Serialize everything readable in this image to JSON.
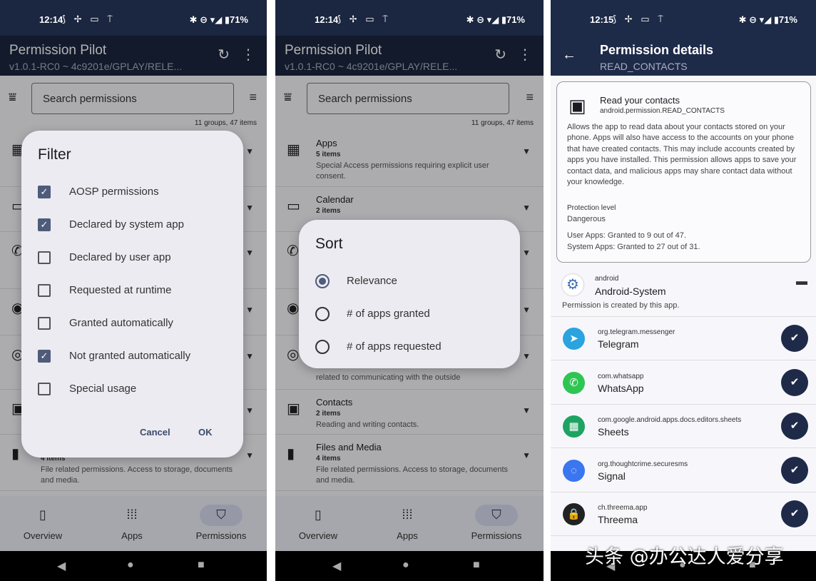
{
  "status_left": {
    "time": "12:14",
    "icons": "⟆ ✢ ▭ ⍑",
    "right": "✱ ⊖ ▾◢ ▮71%"
  },
  "status_right": {
    "time": "12:15",
    "icons": "⟆ ✢ ▭ ⍑",
    "right": "✱ ⊖ ▾◢ ▮71%"
  },
  "app": {
    "title": "Permission Pilot",
    "subtitle": "v1.0.1-RC0 ~ 4c9201e/GPLAY/RELE...",
    "refresh_icon": "↻",
    "more_icon": "⋮"
  },
  "search": {
    "placeholder": "Search permissions",
    "count": "11 groups, 47 items",
    "filter_icon": "⩸",
    "sort_icon": "≡"
  },
  "groups": [
    {
      "icon": "▦",
      "title": "Apps",
      "count": "5 items",
      "desc": "Special Access permissions requiring explicit user consent."
    },
    {
      "icon": "▭",
      "title": "Calendar",
      "count": "2 items",
      "desc": ""
    },
    {
      "icon": "✆",
      "title": "",
      "count": "",
      "desc": ""
    },
    {
      "icon": "◉",
      "title": "",
      "count": "",
      "desc": ""
    },
    {
      "icon": "◎",
      "title": "",
      "count": "",
      "desc": "related to communicating with the outside"
    },
    {
      "icon": "▣",
      "title": "Contacts",
      "count": "2 items",
      "desc": "Reading and writing contacts."
    },
    {
      "icon": "▮",
      "title": "Files and Media",
      "count": "4 items",
      "desc": "File related permissions. Access to storage, documents and media."
    }
  ],
  "bottom_nav": [
    {
      "icon": "▯",
      "label": "Overview"
    },
    {
      "icon": "⁞⁞⁞",
      "label": "Apps"
    },
    {
      "icon": "⛉",
      "label": "Permissions",
      "selected": true
    }
  ],
  "system_nav": {
    "back": "◀",
    "home": "●",
    "recent": "■"
  },
  "filter_dialog": {
    "title": "Filter",
    "options": [
      {
        "label": "AOSP permissions",
        "checked": true
      },
      {
        "label": "Declared by system app",
        "checked": true
      },
      {
        "label": "Declared by user app",
        "checked": false
      },
      {
        "label": "Requested at runtime",
        "checked": false
      },
      {
        "label": "Granted automatically",
        "checked": false
      },
      {
        "label": "Not granted automatically",
        "checked": true
      },
      {
        "label": "Special usage",
        "checked": false
      }
    ],
    "cancel": "Cancel",
    "ok": "OK"
  },
  "sort_dialog": {
    "title": "Sort",
    "options": [
      {
        "label": "Relevance",
        "selected": true
      },
      {
        "label": "# of apps granted",
        "selected": false
      },
      {
        "label": "# of apps requested",
        "selected": false
      }
    ]
  },
  "details": {
    "back_icon": "←",
    "title": "Permission details",
    "subtitle": "READ_CONTACTS",
    "label": "Read your contacts",
    "name": "android.permission.READ_CONTACTS",
    "description": "Allows the app to read data about your contacts stored on your phone. Apps will also have access to the accounts on your phone that have created contacts. This may include accounts created by apps you have installed. This permission allows apps to save your contact data, and malicious apps may share contact data without your knowledge.",
    "protection_label": "Protection level",
    "protection_value": "Dangerous",
    "user_apps": "User Apps: Granted to 9 out of 47.",
    "system_apps": "System Apps: Granted to 27 out of 31.",
    "creator": {
      "pkg": "android",
      "name": "Android-System",
      "note": "Permission is created by this app."
    },
    "apps": [
      {
        "pkg": "org.telegram.messenger",
        "name": "Telegram",
        "color": "#2aa3df",
        "glyph": "➤"
      },
      {
        "pkg": "com.whatsapp",
        "name": "WhatsApp",
        "color": "#2fc552",
        "glyph": "✆"
      },
      {
        "pkg": "com.google.android.apps.docs.editors.sheets",
        "name": "Sheets",
        "color": "#1ea362",
        "glyph": "▦"
      },
      {
        "pkg": "org.thoughtcrime.securesms",
        "name": "Signal",
        "color": "#3a76f0",
        "glyph": "◌"
      },
      {
        "pkg": "ch.threema.app",
        "name": "Threema",
        "color": "#222222",
        "glyph": "🔒"
      }
    ]
  },
  "watermark": "头条 @办公达人爱分享",
  "colors": {
    "appbar": "#1b2640",
    "accent": "#4f5b7a",
    "granted": "#1e2a48"
  }
}
